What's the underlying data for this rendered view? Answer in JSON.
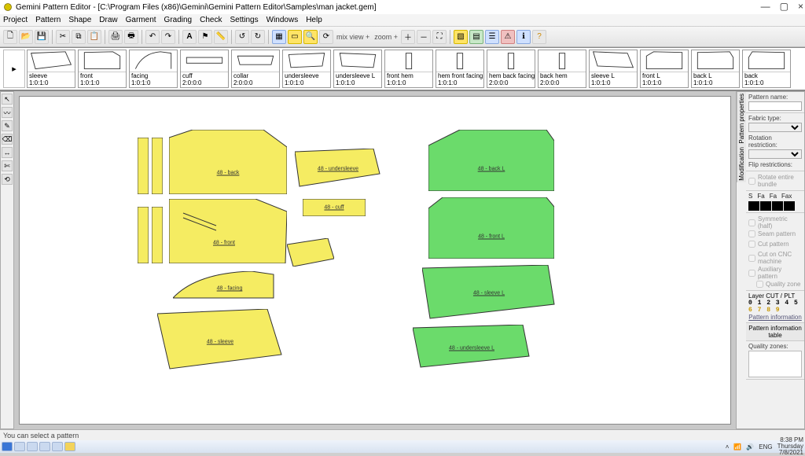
{
  "window": {
    "title": "Gemini Pattern Editor - [C:\\Program Files (x86)\\Gemini\\Gemini Pattern Editor\\Samples\\man jacket.gem]",
    "min": "—",
    "max": "▢",
    "close": "×"
  },
  "menu": [
    "Project",
    "Pattern",
    "Shape",
    "Draw",
    "Garment",
    "Grading",
    "Check",
    "Settings",
    "Windows",
    "Help"
  ],
  "toolbar": {
    "mixview": "mix view +",
    "zoom": "zoom +"
  },
  "shelf": {
    "nav": "▸",
    "pieces": [
      {
        "name": "sleeve",
        "code": "1:0:1:0"
      },
      {
        "name": "front",
        "code": "1:0:1:0"
      },
      {
        "name": "facing",
        "code": "1:0:1:0"
      },
      {
        "name": "cuff",
        "code": "2:0:0:0"
      },
      {
        "name": "collar",
        "code": "2:0:0:0"
      },
      {
        "name": "undersleeve",
        "code": "1:0:1:0"
      },
      {
        "name": "undersleeve L",
        "code": "1:0:1:0"
      },
      {
        "name": "front hem",
        "code": "1:0:1:0"
      },
      {
        "name": "hem front facing",
        "code": "1:0:1:0"
      },
      {
        "name": "hem back facing",
        "code": "2:0:0:0"
      },
      {
        "name": "back hem",
        "code": "2:0:0:0"
      },
      {
        "name": "sleeve L",
        "code": "1:0:1:0"
      },
      {
        "name": "front L",
        "code": "1:0:1:0"
      },
      {
        "name": "back L",
        "code": "1:0:1:0"
      },
      {
        "name": "back",
        "code": "1:0:1:0"
      }
    ]
  },
  "canvas_pieces": {
    "yellow": [
      {
        "label": "48 - back"
      },
      {
        "label": "48 - front"
      },
      {
        "label": "48 - cuff"
      },
      {
        "label": "48 - facing"
      },
      {
        "label": "48 - sleeve"
      },
      {
        "label": "48 - undersleeve"
      }
    ],
    "green": [
      {
        "label": "48 - back L"
      },
      {
        "label": "48 - front L"
      },
      {
        "label": "48 - sleeve L"
      },
      {
        "label": "48 - undersleeve L"
      }
    ]
  },
  "panel": {
    "pattern_name_label": "Pattern name:",
    "fabric_type_label": "Fabric type:",
    "rotation_label": "Rotation restriction:",
    "flip_label": "Flip restrictions:",
    "rotate_bundle": "Rotate entire bundle",
    "hdr": {
      "s": "S",
      "fa": "Fa",
      "fa2": "Fa",
      "fax": "Fax"
    },
    "sym": "Symmetric (half)",
    "seam": "Seam pattern",
    "cut": "Cut pattern",
    "cnc": "Cut on CNC machine",
    "aux": "Auxiliary pattern",
    "qz": "Quality zone",
    "layer": "Layer CUT / PLT",
    "layers_digits": "0 1 2 3 4 5",
    "layers_digits2": "6 7 8 9",
    "patt_info": "Pattern information",
    "patt_table": "Pattern information table",
    "quality_zones": "Quality zones:",
    "sidetab1": "Pattern properties",
    "sidetab2": "Modification"
  },
  "status": "You can select a pattern",
  "tray": {
    "lang": "ENG",
    "time": "8:38 PM",
    "day": "Thursday",
    "date": "7/8/2021"
  }
}
